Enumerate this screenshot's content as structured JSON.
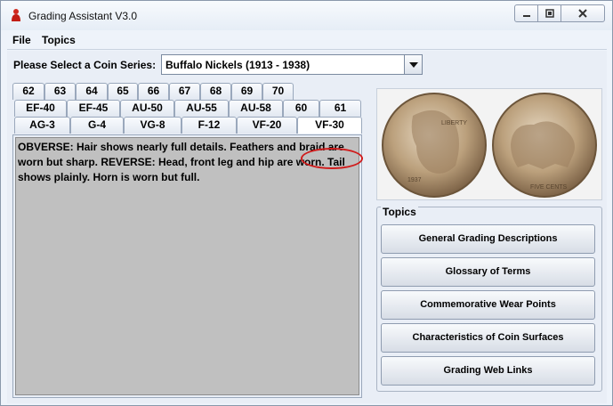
{
  "window": {
    "title": "Grading Assistant V3.0",
    "menu": [
      "File",
      "Topics"
    ]
  },
  "series": {
    "label": "Please Select a Coin Series:",
    "selected": "Buffalo Nickels (1913 - 1938)"
  },
  "tabs": {
    "row1": [
      "62",
      "63",
      "64",
      "65",
      "66",
      "67",
      "68",
      "69",
      "70"
    ],
    "row2": [
      "EF-40",
      "EF-45",
      "AU-50",
      "AU-55",
      "AU-58",
      "60",
      "61"
    ],
    "row3": [
      "AG-3",
      "G-4",
      "VG-8",
      "F-12",
      "VF-20",
      "VF-30"
    ],
    "selected": "VF-30"
  },
  "description": "OBVERSE: Hair shows nearly full details. Feathers and braid are worn but sharp.  REVERSE: Head, front leg and hip are worn. Tail shows plainly. Horn is worn but full.",
  "coins": {
    "obverse_legend": "LIBERTY",
    "obverse_date": "1937",
    "reverse_legend": "FIVE CENTS"
  },
  "topics": {
    "title": "Topics",
    "buttons": [
      "General Grading Descriptions",
      "Glossary of Terms",
      "Commemorative Wear Points",
      "Characteristics of Coin Surfaces",
      "Grading Web Links"
    ]
  },
  "colors": {
    "highlight_circle": "#d01c1c",
    "text_area": "#c0c0c0"
  }
}
